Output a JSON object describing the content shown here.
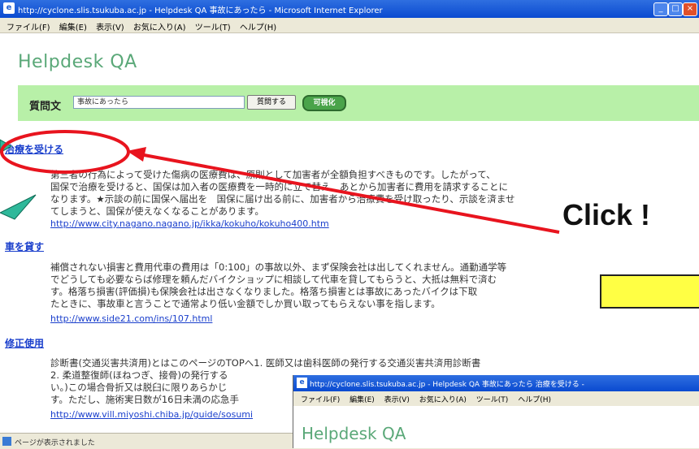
{
  "window": {
    "title": "http://cyclone.slis.tsukuba.ac.jp - Helpdesk QA 事故にあったら - Microsoft Internet Explorer",
    "menu": [
      "ファイル(F)",
      "編集(E)",
      "表示(V)",
      "お気に入り(A)",
      "ツール(T)",
      "ヘルプ(H)"
    ]
  },
  "page": {
    "logo": "Helpdesk QA",
    "question_label": "質問文",
    "question_value": "事故にあったら",
    "btn_search": "質問する",
    "btn_detail": "可視化"
  },
  "results": [
    {
      "heading": "治療を受ける",
      "lines": [
        "第三者の行為によって受けた傷病の医療費は、原則として加害者が全額負担すべきものです。したがって、",
        "国保で治療を受けると、国保は加入者の医療費を一時的に立て替え、あとから加害者に費用を請求することに",
        "なります。★示談の前に国保へ届出を　国保に届け出る前に、加害者から治療費を受け取ったり、示談を済ませ",
        "てしまうと、国保が使えなくなることがあります。"
      ],
      "url": "http://www.city.nagano.nagano.jp/ikka/kokuho/kokuho400.htm"
    },
    {
      "heading": "車を貸す",
      "lines": [
        "補償されない損害と費用代車の費用は「0:100」の事故以外、まず保険会社は出してくれません。通勤通学等",
        "でどうしても必要ならば修理を頼んだバイクショップに相談して代車を貸してもらうと、大抵は無料で済む",
        "す。格落ち損害(評価損)も保険会社は出さなくなりました。格落ち損害とは事故にあったバイクは下取",
        "たときに、事故車と言うことで通常より低い金額でしか買い取ってもらえない事を指します。"
      ],
      "url": "http://www.side21.com/ins/107.html"
    },
    {
      "heading": "修正使用",
      "lines": [
        "診断書(交通災害共済用)とはこのページのTOPへ1. 医師又は歯科医師の発行する交通災害共済用診断書",
        "2. 柔道整復師(ほねつぎ、接骨)の発行する",
        "い。)この場合骨折又は脱臼に限りあらかじ",
        "す。ただし、施術実日数が16日未満の応急手"
      ],
      "url": "http://www.vill.miyoshi.chiba.jp/guide/sosumi"
    }
  ],
  "status_text": "ページが表示されました",
  "window2": {
    "title": "http://cyclone.slis.tsukuba.ac.jp - Helpdesk QA 事故にあったら 治療を受ける -",
    "menu": [
      "ファイル(F)",
      "編集(E)",
      "表示(V)",
      "お気に入り(A)",
      "ツール(T)",
      "ヘルプ(H)"
    ],
    "logo": "Helpdesk QA"
  },
  "annotation": {
    "click_text": "Click !"
  },
  "colors": {
    "highlight_ellipse": "#e8141e",
    "arrow": "#e8141e",
    "callout": "#2fb89a",
    "question_bar": "#b8f0a8",
    "yellow_box": "#ffff44"
  }
}
